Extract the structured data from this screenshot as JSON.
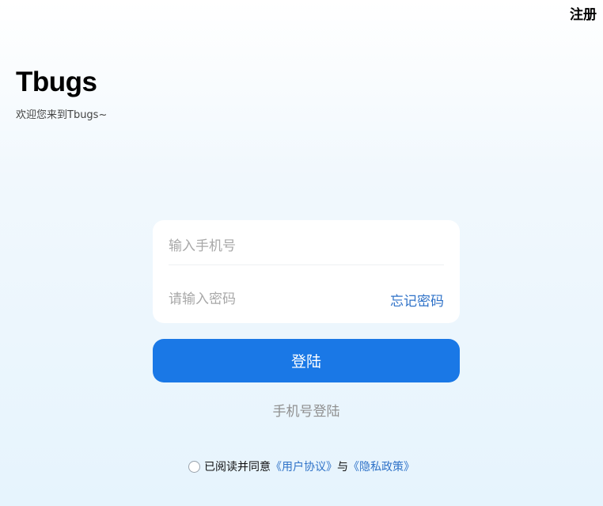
{
  "header": {
    "register_label": "注册"
  },
  "brand": {
    "title": "Tbugs",
    "subtitle": "欢迎您来到Tbugs~"
  },
  "form": {
    "phone_placeholder": "输入手机号",
    "phone_value": "",
    "password_placeholder": "请输入密码",
    "password_value": "",
    "forgot_label": "忘记密码",
    "login_label": "登陆",
    "alt_login_label": "手机号登陆"
  },
  "agreement": {
    "checked": false,
    "prefix": "已阅读并同意",
    "user_agreement": "《用户协议》",
    "conjunction": "与",
    "privacy_policy": "《隐私政策》"
  },
  "colors": {
    "primary": "#1a78e6",
    "link": "#2f72c8",
    "placeholder": "#a8a8a8",
    "background_top": "#ffffff",
    "background_bottom": "#e6f4fd"
  }
}
